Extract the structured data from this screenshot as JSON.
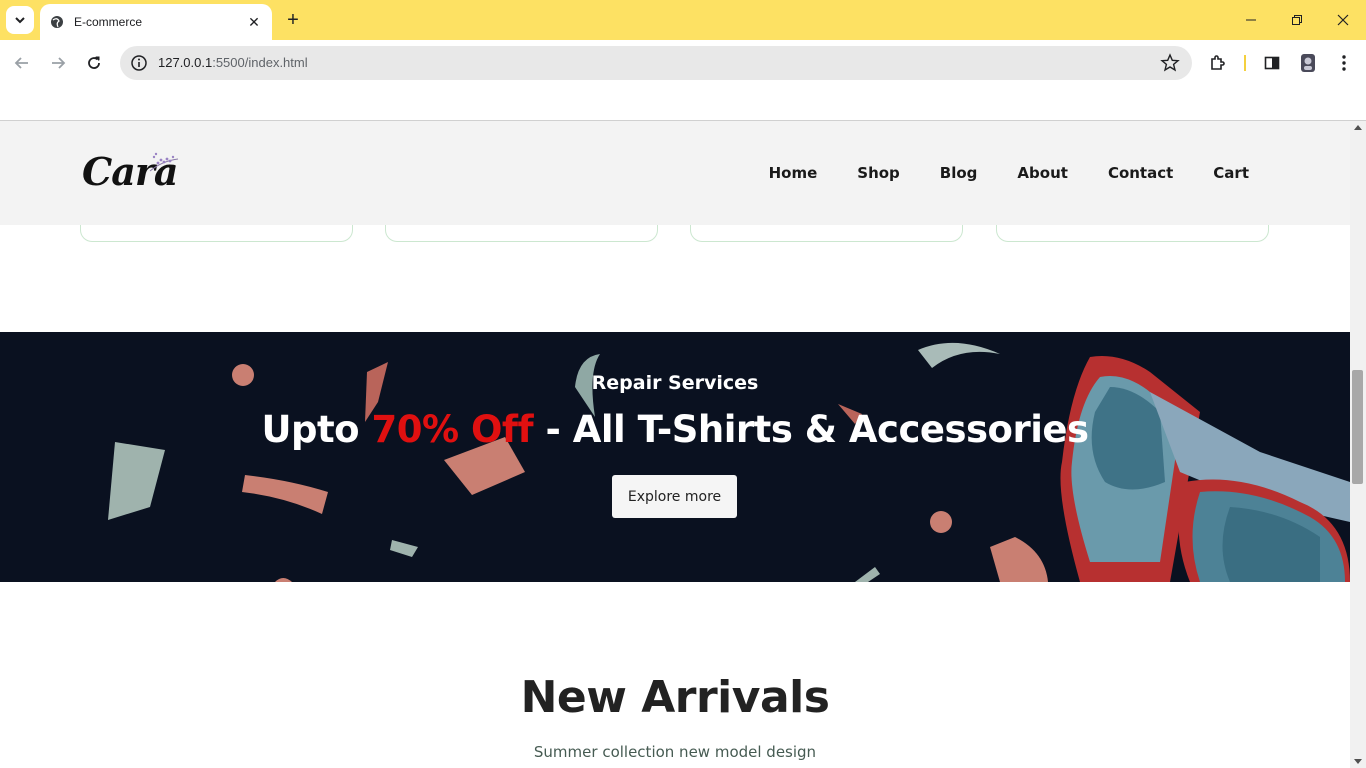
{
  "browser": {
    "tab_title": "E-commerce",
    "url_host": "127.0.0.1",
    "url_path": ":5500/index.html",
    "colors": {
      "tabbar": "#fde163"
    }
  },
  "site": {
    "logo": "Cara",
    "nav": [
      "Home",
      "Shop",
      "Blog",
      "About",
      "Contact",
      "Cart"
    ]
  },
  "banner": {
    "subtitle": "Repair Services",
    "headline_before": "Upto ",
    "headline_highlight": "70% Off",
    "headline_after": " - All T-Shirts & Accessories",
    "button": "Explore more",
    "colors": {
      "background": "#0a1120",
      "highlight": "#e01010"
    }
  },
  "section": {
    "title": "New Arrivals",
    "subtitle": "Summer collection new model design"
  }
}
